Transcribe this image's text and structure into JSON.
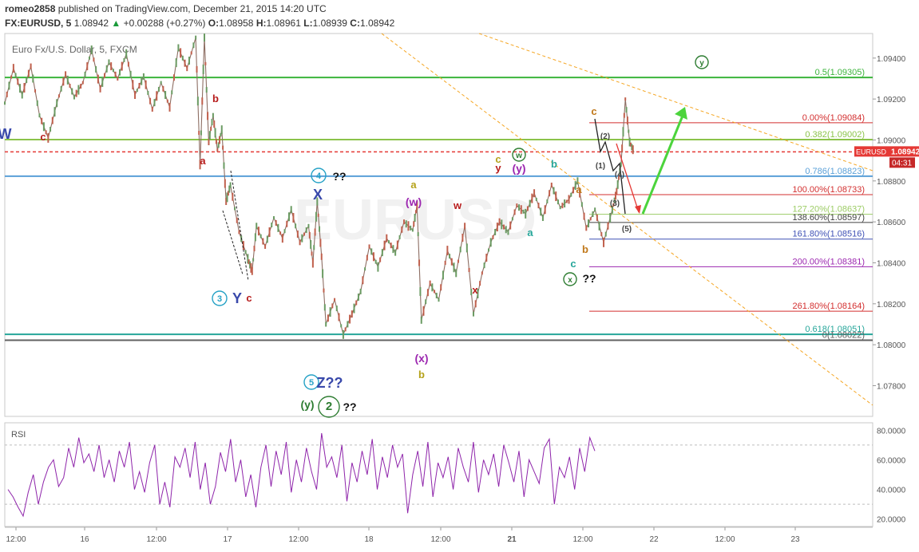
{
  "header": {
    "user": "romeo2858",
    "published": "published on TradingView.com, December 21, 2015 14:20 UTC",
    "symbol": "FX:EURUSD, 5",
    "last": "1.08942",
    "change": "+0.00288 (+0.27%)",
    "o_label": "O:",
    "o": "1.08958",
    "h_label": "H:",
    "h": "1.08961",
    "l_label": "L:",
    "l": "1.08939",
    "c_label": "C:",
    "c": "1.08942"
  },
  "chart_data": [
    {
      "type": "line",
      "subtype": "candlestick price chart with Elliott wave annotations",
      "title": "Euro Fx/U.S. Dollar, 5, FXCM",
      "watermark": "EURUSD",
      "symbol_tag": "EURUSD",
      "price_tag": "1.08942",
      "countdown": "04:31",
      "ylim": [
        1.0765,
        1.0952
      ],
      "y_ticks": [
        "1.09400",
        "1.09200",
        "1.09000",
        "1.08800",
        "1.08600",
        "1.08400",
        "1.08200",
        "1.08000",
        "1.07800"
      ],
      "x_ticks": [
        "12:00",
        "16",
        "12:00",
        "17",
        "12:00",
        "18",
        "12:00",
        "21",
        "12:00",
        "22",
        "12:00",
        "23"
      ],
      "price_path": [
        [
          0.0,
          1.0918
        ],
        [
          0.01,
          1.0935
        ],
        [
          0.02,
          1.0922
        ],
        [
          0.03,
          1.0936
        ],
        [
          0.04,
          1.0912
        ],
        [
          0.05,
          1.0901
        ],
        [
          0.06,
          1.0918
        ],
        [
          0.07,
          1.0932
        ],
        [
          0.08,
          1.0921
        ],
        [
          0.09,
          1.0928
        ],
        [
          0.1,
          1.0944
        ],
        [
          0.11,
          1.0925
        ],
        [
          0.12,
          1.0938
        ],
        [
          0.13,
          1.093
        ],
        [
          0.14,
          1.0942
        ],
        [
          0.15,
          1.0922
        ],
        [
          0.16,
          1.0931
        ],
        [
          0.17,
          1.0915
        ],
        [
          0.18,
          1.0928
        ],
        [
          0.19,
          1.0916
        ],
        [
          0.2,
          1.0945
        ],
        [
          0.21,
          1.0935
        ],
        [
          0.22,
          1.095
        ],
        [
          0.225,
          1.0888
        ],
        [
          0.23,
          1.095
        ],
        [
          0.235,
          1.0899
        ],
        [
          0.24,
          1.0912
        ],
        [
          0.245,
          1.0895
        ],
        [
          0.25,
          1.0905
        ],
        [
          0.255,
          1.087
        ],
        [
          0.26,
          1.0878
        ],
        [
          0.27,
          1.0855
        ],
        [
          0.28,
          1.0842
        ],
        [
          0.285,
          1.0836
        ],
        [
          0.29,
          1.0858
        ],
        [
          0.3,
          1.0848
        ],
        [
          0.31,
          1.0862
        ],
        [
          0.32,
          1.0852
        ],
        [
          0.33,
          1.0866
        ],
        [
          0.34,
          1.085
        ],
        [
          0.35,
          1.0858
        ],
        [
          0.355,
          1.084
        ],
        [
          0.36,
          1.087
        ],
        [
          0.365,
          1.0843
        ],
        [
          0.37,
          1.081
        ],
        [
          0.38,
          1.0822
        ],
        [
          0.39,
          1.0805
        ],
        [
          0.4,
          1.0815
        ],
        [
          0.41,
          1.0826
        ],
        [
          0.42,
          1.0848
        ],
        [
          0.43,
          1.0838
        ],
        [
          0.44,
          1.0852
        ],
        [
          0.45,
          1.0845
        ],
        [
          0.46,
          1.086
        ],
        [
          0.47,
          1.0856
        ],
        [
          0.475,
          1.0868
        ],
        [
          0.48,
          1.0812
        ],
        [
          0.49,
          1.083
        ],
        [
          0.5,
          1.0822
        ],
        [
          0.51,
          1.0846
        ],
        [
          0.52,
          1.0835
        ],
        [
          0.53,
          1.0858
        ],
        [
          0.54,
          1.0815
        ],
        [
          0.55,
          1.0835
        ],
        [
          0.56,
          1.085
        ],
        [
          0.57,
          1.086
        ],
        [
          0.58,
          1.0855
        ],
        [
          0.59,
          1.0868
        ],
        [
          0.6,
          1.0864
        ],
        [
          0.61,
          1.0874
        ],
        [
          0.62,
          1.0862
        ],
        [
          0.63,
          1.0878
        ],
        [
          0.64,
          1.0867
        ],
        [
          0.65,
          1.0871
        ],
        [
          0.66,
          1.088
        ],
        [
          0.67,
          1.0857
        ],
        [
          0.68,
          1.0866
        ],
        [
          0.69,
          1.085
        ],
        [
          0.7,
          1.0866
        ],
        [
          0.705,
          1.0875
        ],
        [
          0.71,
          1.0888
        ],
        [
          0.715,
          1.092
        ],
        [
          0.72,
          1.0899
        ],
        [
          0.725,
          1.0894
        ]
      ],
      "horizontal_levels": [
        {
          "label": "0.5(1.09305)",
          "value": 1.09305,
          "color": "#3cb43c"
        },
        {
          "label": "0.00%(1.09084)",
          "value": 1.09084,
          "color": "#d32f2f"
        },
        {
          "label": "0.382(1.09002)",
          "value": 1.09002,
          "color": "#8bc34a"
        },
        {
          "label": "0.786(1.08823)",
          "value": 1.08823,
          "color": "#5aa0d8"
        },
        {
          "label": "100.00%(1.08733)",
          "value": 1.08733,
          "color": "#d32f2f"
        },
        {
          "label": "127.20%(1.08637)",
          "value": 1.08637,
          "color": "#9ccc65"
        },
        {
          "label": "138.60%(1.08597)",
          "value": 1.08597,
          "color": "#424242"
        },
        {
          "label": "161.80%(1.08516)",
          "value": 1.08516,
          "color": "#3f51b5"
        },
        {
          "label": "200.00%(1.08381)",
          "value": 1.08381,
          "color": "#9c27b0"
        },
        {
          "label": "261.80%(1.08164)",
          "value": 1.08164,
          "color": "#d32f2f"
        },
        {
          "label": "0.618(1.08051)",
          "value": 1.08051,
          "color": "#26a69a"
        },
        {
          "label": "0(1.08022)",
          "value": 1.08022,
          "color": "#616161"
        }
      ],
      "wave_labels": [
        {
          "text": "W",
          "color": "#3949ab"
        },
        {
          "text": "c",
          "color": "#b71c1c"
        },
        {
          "text": "b",
          "color": "#b71c1c"
        },
        {
          "text": "a",
          "color": "#b71c1c"
        },
        {
          "text": "c",
          "color": "#b71c1c"
        },
        {
          "text": "4",
          "color": "#26a2c6"
        },
        {
          "text": "??",
          "color": "#111111"
        },
        {
          "text": "X",
          "color": "#3949ab"
        },
        {
          "text": "3",
          "color": "#26a2c6"
        },
        {
          "text": "Y",
          "color": "#3949ab"
        },
        {
          "text": "5",
          "color": "#26a2c6"
        },
        {
          "text": "Z??",
          "color": "#3949ab"
        },
        {
          "text": "(y)",
          "color": "#2e7d32"
        },
        {
          "text": "2",
          "color": "#2e7d32"
        },
        {
          "text": "??",
          "color": "#111111"
        },
        {
          "text": "a",
          "color": "#b5a21a"
        },
        {
          "text": "(w)",
          "color": "#9c27b0"
        },
        {
          "text": "w",
          "color": "#b71c1c"
        },
        {
          "text": "x",
          "color": "#b71c1c"
        },
        {
          "text": "(x)",
          "color": "#9c27b0"
        },
        {
          "text": "b",
          "color": "#b5a21a"
        },
        {
          "text": "c",
          "color": "#b5a21a"
        },
        {
          "text": "y",
          "color": "#b71c1c"
        },
        {
          "text": "w",
          "color": "#2e7d32"
        },
        {
          "text": "(y)",
          "color": "#9c27b0"
        },
        {
          "text": "a",
          "color": "#26a69a"
        },
        {
          "text": "b",
          "color": "#26a69a"
        },
        {
          "text": "a",
          "color": "#c0781a"
        },
        {
          "text": "b",
          "color": "#c0781a"
        },
        {
          "text": "c",
          "color": "#26a69a"
        },
        {
          "text": "x",
          "color": "#2e7d32"
        },
        {
          "text": "??",
          "color": "#111111"
        },
        {
          "text": "c",
          "color": "#c0781a"
        },
        {
          "text": "(2)",
          "color": "#444444"
        },
        {
          "text": "(1)",
          "color": "#444444"
        },
        {
          "text": "(4)",
          "color": "#444444"
        },
        {
          "text": "(3)",
          "color": "#444444"
        },
        {
          "text": "(5)",
          "color": "#444444"
        },
        {
          "text": "y",
          "color": "#2e7d32"
        }
      ]
    },
    {
      "type": "line",
      "title": "RSI",
      "ylim": [
        15,
        85
      ],
      "y_ticks": [
        "80.0000",
        "60.0000",
        "40.0000",
        "20.0000"
      ],
      "bands": [
        70,
        30
      ],
      "series": [
        {
          "values": [
            40,
            35,
            28,
            22,
            38,
            50,
            30,
            45,
            55,
            60,
            42,
            48,
            68,
            55,
            75,
            58,
            64,
            52,
            70,
            48,
            60,
            45,
            66,
            55,
            72,
            40,
            52,
            38,
            58,
            70,
            30,
            45,
            28,
            62,
            55,
            68,
            48,
            72,
            40,
            58,
            30,
            42,
            65,
            52,
            74,
            45,
            60,
            35,
            50,
            28,
            55,
            70,
            42,
            66,
            50,
            72,
            38,
            60,
            45,
            68,
            52,
            40,
            78,
            55,
            62,
            48,
            70,
            32,
            58,
            45,
            66,
            50,
            74,
            40,
            62,
            48,
            70,
            55,
            64,
            24,
            50,
            66,
            42,
            72,
            35,
            58,
            48,
            62,
            40,
            68,
            55,
            45,
            72,
            38,
            60,
            50,
            64,
            42,
            70,
            58,
            45,
            66,
            35,
            60,
            52,
            44,
            68,
            74,
            30,
            55,
            48,
            62,
            40,
            68,
            52,
            75,
            66
          ]
        }
      ]
    }
  ]
}
